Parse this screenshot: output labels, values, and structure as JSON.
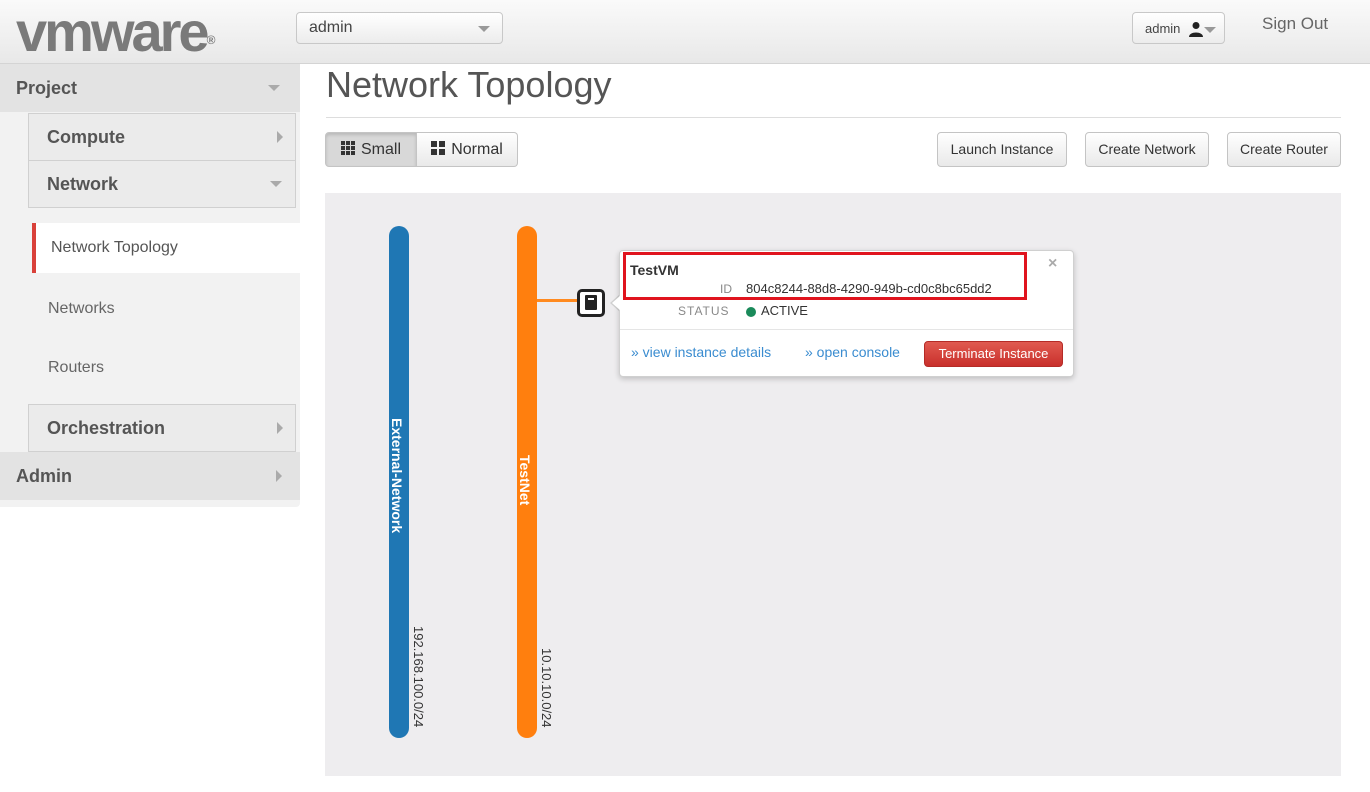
{
  "header": {
    "logo_text": "vmware",
    "logo_mark": "®",
    "project_selector": "admin",
    "user_menu": "admin",
    "sign_out": "Sign Out"
  },
  "sidebar": {
    "project": "Project",
    "compute": "Compute",
    "network": "Network",
    "network_links": [
      "Network Topology",
      "Networks",
      "Routers"
    ],
    "orchestration": "Orchestration",
    "admin": "Admin"
  },
  "main": {
    "title": "Network Topology",
    "view_small": "Small",
    "view_normal": "Normal",
    "launch_instance": "Launch Instance",
    "create_network": "Create Network",
    "create_router": "Create Router"
  },
  "topology": {
    "networks": [
      {
        "name": "External-Network",
        "cidr": "192.168.100.0/24",
        "color": "#1f77b4"
      },
      {
        "name": "TestNet",
        "cidr": "10.10.10.0/24",
        "color": "#ff7f0e"
      }
    ],
    "instance_balloon": {
      "name": "TestVM",
      "id_label": "ID",
      "id": "804c8244-88d8-4290-949b-cd0c8bc65dd2",
      "status_label": "STATUS",
      "status": "ACTIVE",
      "status_color": "#1a8a5a",
      "close": "×",
      "view_details": "» view instance details",
      "open_console": "» open console",
      "terminate": "Terminate Instance"
    }
  },
  "colors": {
    "accent_active": "#d9413a",
    "highlight": "#e0141e",
    "link": "#3a8cd0",
    "danger": "#c9302c"
  }
}
